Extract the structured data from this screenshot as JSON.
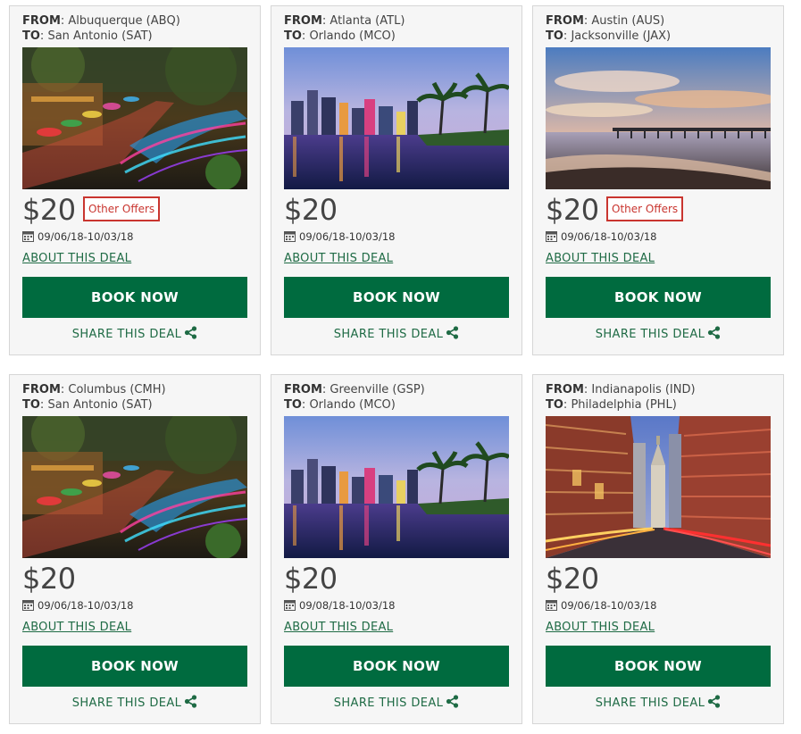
{
  "labels": {
    "from": "FROM",
    "to": "TO",
    "other_offers": "Other Offers",
    "about": "ABOUT THIS DEAL",
    "book": "BOOK NOW",
    "share": "SHARE THIS DEAL"
  },
  "deals": [
    {
      "from": "Albuquerque (ABQ)",
      "to": "San Antonio (SAT)",
      "price": "$20",
      "dates": "09/06/18-10/03/18",
      "image": "san-antonio-riverwalk",
      "has_offers": true
    },
    {
      "from": "Atlanta (ATL)",
      "to": "Orlando (MCO)",
      "price": "$20",
      "dates": "09/06/18-10/03/18",
      "image": "orlando-skyline",
      "has_offers": false
    },
    {
      "from": "Austin (AUS)",
      "to": "Jacksonville (JAX)",
      "price": "$20",
      "dates": "09/06/18-10/03/18",
      "image": "jacksonville-beach-pier",
      "has_offers": true
    },
    {
      "from": "Columbus (CMH)",
      "to": "San Antonio (SAT)",
      "price": "$20",
      "dates": "09/06/18-10/03/18",
      "image": "san-antonio-riverwalk",
      "has_offers": false
    },
    {
      "from": "Greenville (GSP)",
      "to": "Orlando (MCO)",
      "price": "$20",
      "dates": "09/08/18-10/03/18",
      "image": "orlando-skyline",
      "has_offers": false
    },
    {
      "from": "Indianapolis (IND)",
      "to": "Philadelphia (PHL)",
      "price": "$20",
      "dates": "09/06/18-10/03/18",
      "image": "philadelphia-city-hall",
      "has_offers": false
    }
  ],
  "colors": {
    "accent": "#006b3f",
    "link": "#1f6b45",
    "offers": "#c9352f",
    "card_bg": "#f6f6f6"
  }
}
